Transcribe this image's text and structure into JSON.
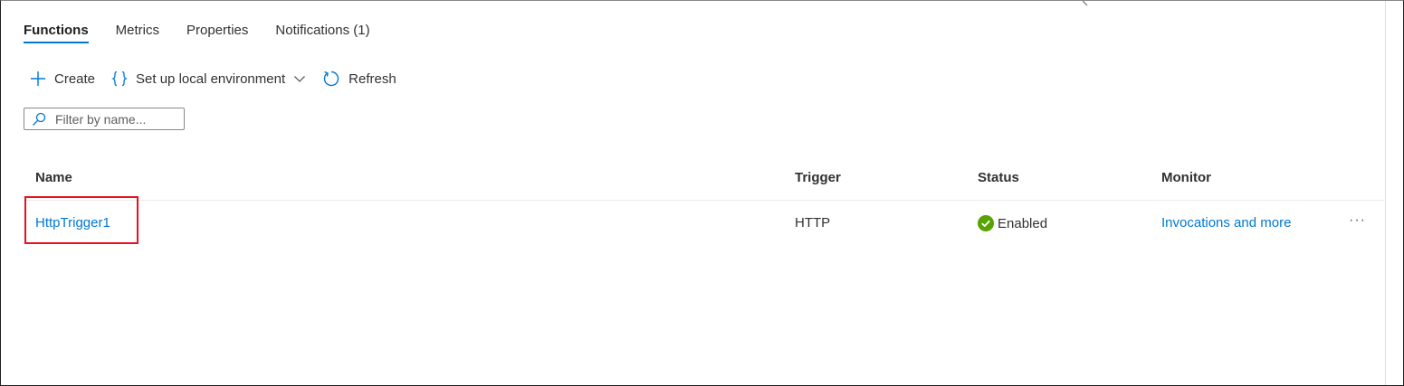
{
  "tabs": [
    {
      "label": "Functions",
      "active": true
    },
    {
      "label": "Metrics",
      "active": false
    },
    {
      "label": "Properties",
      "active": false
    },
    {
      "label": "Notifications (1)",
      "active": false
    }
  ],
  "toolbar": {
    "create_label": "Create",
    "local_env_label": "Set up local environment",
    "refresh_label": "Refresh"
  },
  "filter": {
    "placeholder": "Filter by name...",
    "value": ""
  },
  "table": {
    "columns": [
      "Name",
      "Trigger",
      "Status",
      "Monitor"
    ],
    "rows": [
      {
        "name": "HttpTrigger1",
        "trigger": "HTTP",
        "status": "Enabled",
        "monitor": "Invocations and more",
        "more": "···"
      }
    ]
  },
  "colors": {
    "accent": "#0078d4",
    "success": "#57a300",
    "highlight": "#e81123"
  },
  "icons": {
    "create": "plus-icon",
    "local_env": "curly-braces-icon",
    "dropdown": "chevron-down-icon",
    "refresh": "refresh-icon",
    "search": "search-icon",
    "status": "check-circle-icon",
    "more": "more-icon"
  }
}
